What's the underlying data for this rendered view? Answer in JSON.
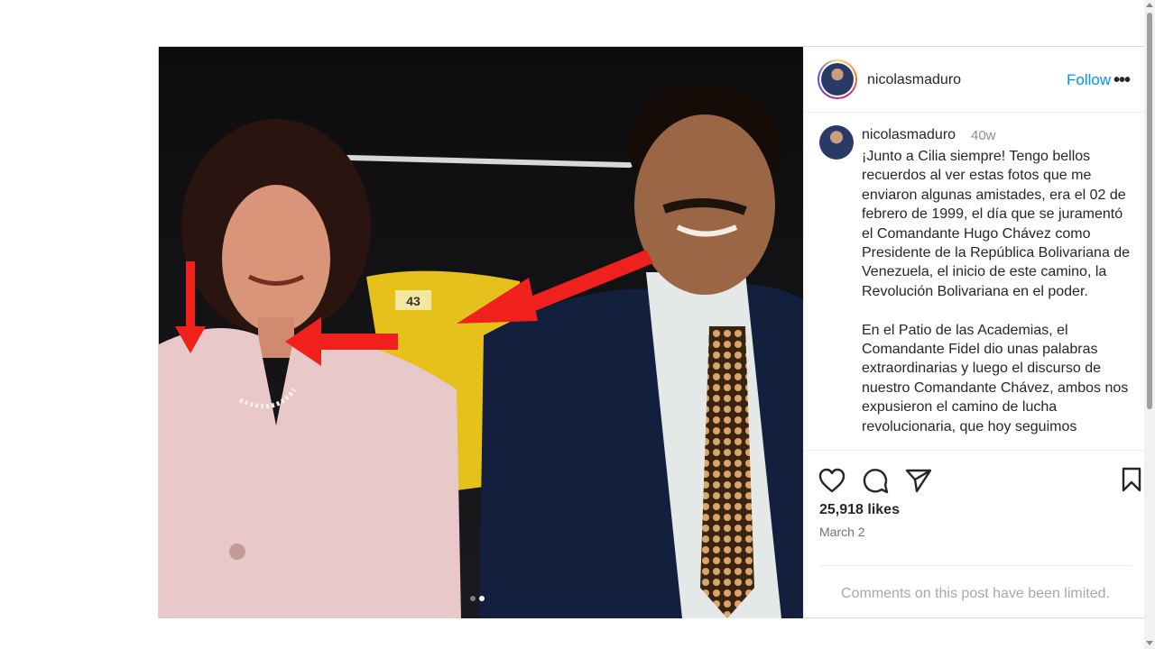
{
  "post": {
    "username": "nicolasmaduro",
    "follow_label": "Follow",
    "more_label": "•••",
    "caption": {
      "username": "nicolasmaduro",
      "time": "40w",
      "text": "¡Junto a Cilia siempre! Tengo bellos recuerdos al ver estas fotos que me enviaron algunas amistades, era el 02 de febrero de 1999, el día que se juramentó el Comandante Hugo Chávez como Presidente de la República Bolivariana de Venezuela, el inicio de este camino, la Revolución Bolivariana en el poder.\n\nEn el Patio de las Academias, el Comandante Fidel dio unas palabras extraordinarias y luego el discurso de nuestro Comandante Chávez, ambos nos expusieron el camino de lucha revolucionaria, que hoy seguimos"
    },
    "likes": "25,918 likes",
    "date": "March 2",
    "comments_limited": "Comments on this post have been limited.",
    "photo": {
      "seat_number": "43",
      "slide_count": 2,
      "active_slide": 2
    },
    "icons": {
      "like": "heart-icon",
      "comment": "comment-icon",
      "share": "share-icon",
      "save": "bookmark-icon"
    },
    "colors": {
      "accent": "#0095f6",
      "annotation_arrow": "#f0201c"
    }
  }
}
